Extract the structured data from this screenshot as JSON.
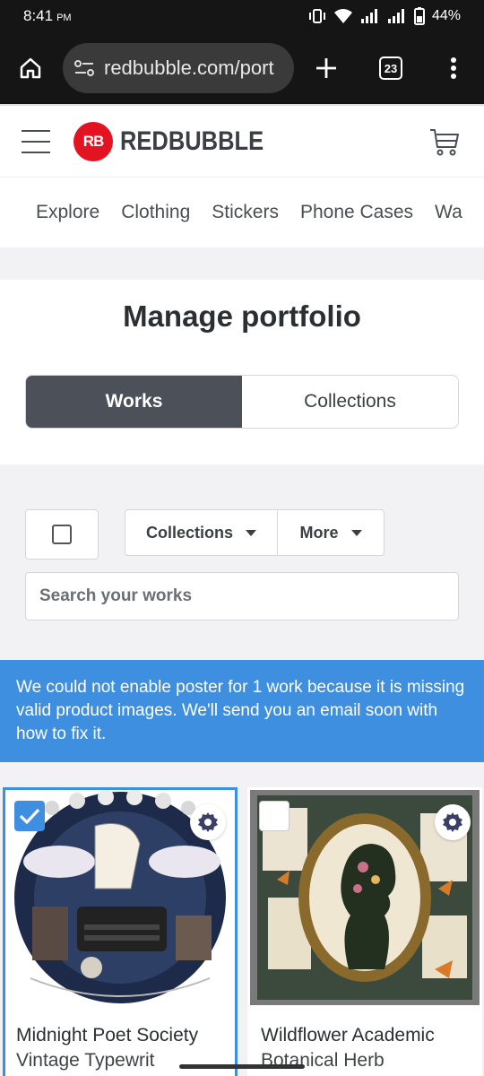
{
  "status_bar": {
    "time": "8:41",
    "ampm": "PM",
    "battery": "44%"
  },
  "browser": {
    "url": "redbubble.com/port",
    "tab_count": "23"
  },
  "header": {
    "logo_mark": "RB",
    "logo_text": "REDBUBBLE"
  },
  "nav": {
    "items": [
      "Explore",
      "Clothing",
      "Stickers",
      "Phone Cases",
      "Wa"
    ]
  },
  "manage": {
    "title": "Manage portfolio",
    "tab_works": "Works",
    "tab_collections": "Collections"
  },
  "toolbar": {
    "collections_label": "Collections",
    "more_label": "More"
  },
  "search": {
    "placeholder": "Search your works"
  },
  "alert": {
    "message": "We could not enable poster for 1 work because it is missing valid product images. We'll send you an email soon with how to fix it."
  },
  "works": [
    {
      "title": "Midnight Poet Society",
      "title_line2": "Vintage Typewrit",
      "selected": true
    },
    {
      "title": "Wildflower Academic",
      "title_line2": "Botanical Herb",
      "selected": false
    }
  ],
  "colors": {
    "brand_red": "#e41321",
    "accent_blue": "#3f8fe0",
    "active_tab": "#4b5059"
  }
}
